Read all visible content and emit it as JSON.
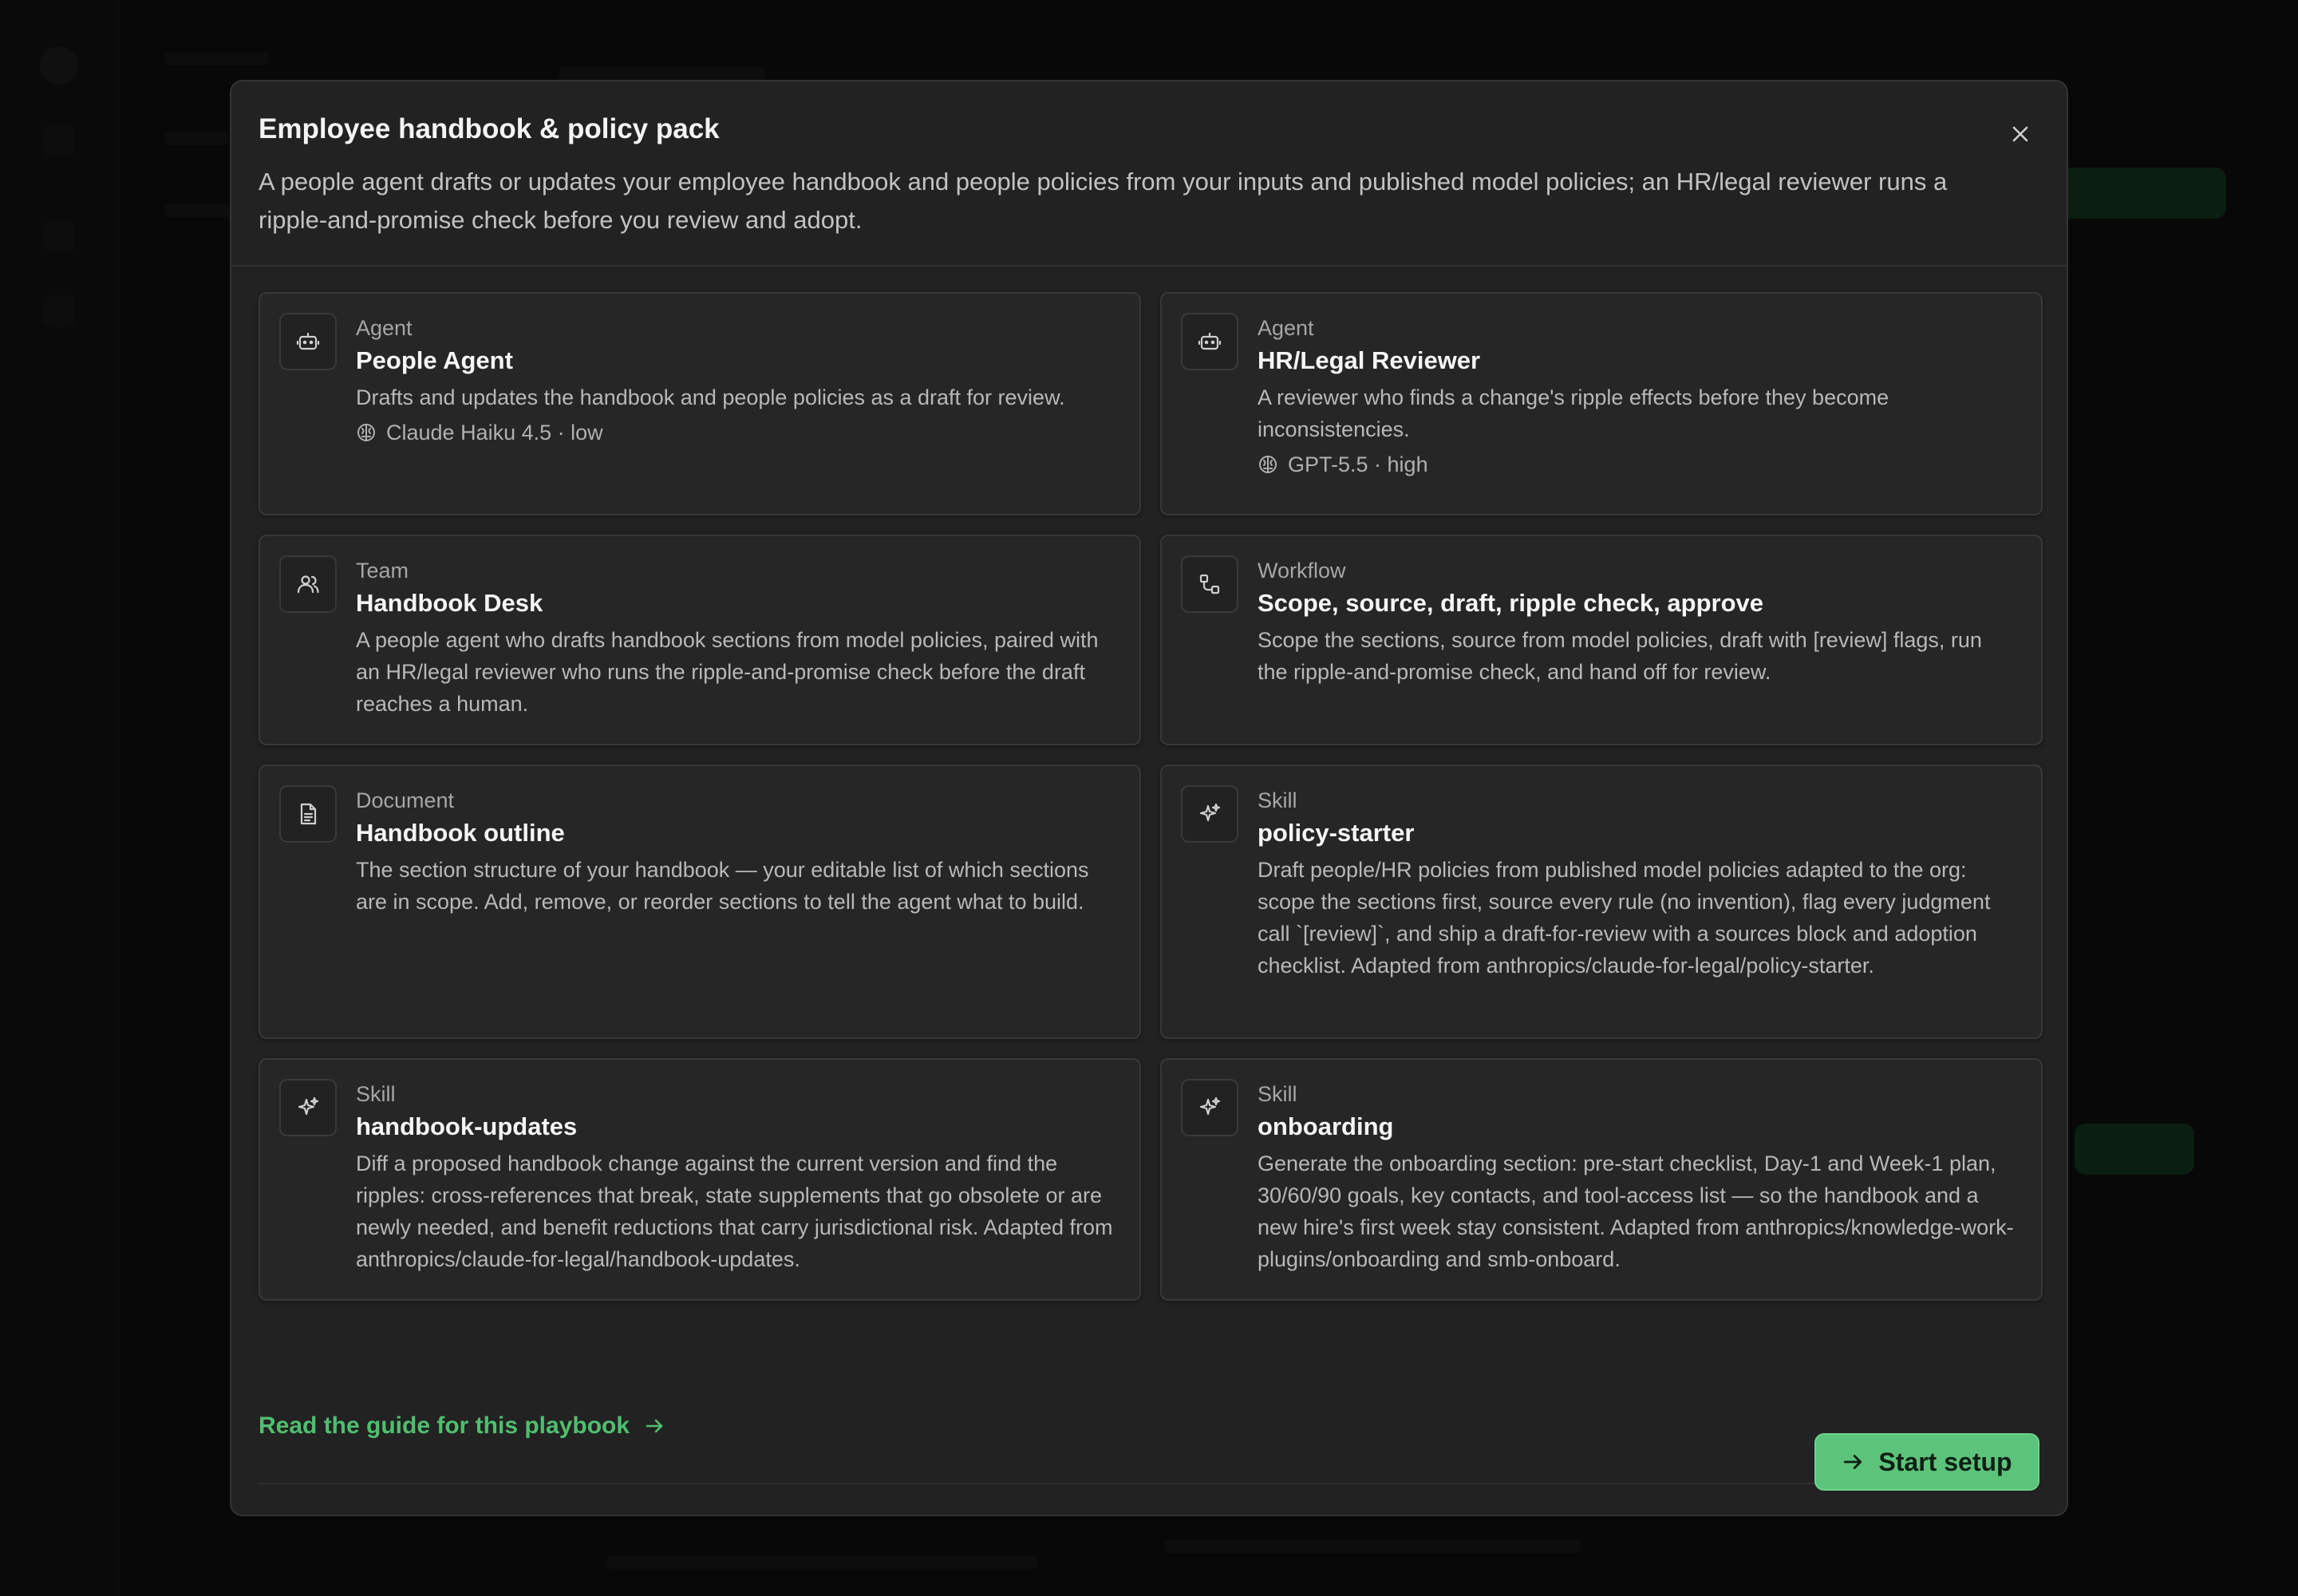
{
  "modal": {
    "title": "Employee handbook & policy pack",
    "description": "A people agent drafts or updates your employee handbook and people policies from your inputs and published model policies; an HR/legal reviewer runs a ripple-and-promise check before you review and adopt."
  },
  "cards": [
    {
      "kind": "Agent",
      "title": "People Agent",
      "description": "Drafts and updates the handbook and people policies as a draft for review.",
      "model": "Claude Haiku 4.5 · low",
      "icon": "robot-icon"
    },
    {
      "kind": "Agent",
      "title": "HR/Legal Reviewer",
      "description": "A reviewer who finds a change's ripple effects before they become inconsistencies.",
      "model": "GPT-5.5 · high",
      "icon": "robot-icon"
    },
    {
      "kind": "Team",
      "title": "Handbook Desk",
      "description": "A people agent who drafts handbook sections from model policies, paired with an HR/legal reviewer who runs the ripple-and-promise check before the draft reaches a human.",
      "icon": "users-icon"
    },
    {
      "kind": "Workflow",
      "title": "Scope, source, draft, ripple check, approve",
      "description": "Scope the sections, source from model policies, draft with [review] flags, run the ripple-and-promise check, and hand off for review.",
      "icon": "workflow-icon"
    },
    {
      "kind": "Document",
      "title": "Handbook outline",
      "description": "The section structure of your handbook — your editable list of which sections are in scope. Add, remove, or reorder sections to tell the agent what to build.",
      "icon": "document-icon"
    },
    {
      "kind": "Skill",
      "title": "policy-starter",
      "description": "Draft people/HR policies from published model policies adapted to the org: scope the sections first, source every rule (no invention), flag every judgment call `[review]`, and ship a draft-for-review with a sources block and adoption checklist. Adapted from anthropics/claude-for-legal/policy-starter.",
      "icon": "sparkle-icon"
    },
    {
      "kind": "Skill",
      "title": "handbook-updates",
      "description": "Diff a proposed handbook change against the current version and find the ripples: cross-references that break, state supplements that go obsolete or are newly needed, and benefit reductions that carry jurisdictional risk. Adapted from anthropics/claude-for-legal/handbook-updates.",
      "icon": "sparkle-icon"
    },
    {
      "kind": "Skill",
      "title": "onboarding",
      "description": "Generate the onboarding section: pre-start checklist, Day-1 and Week-1 plan, 30/60/90 goals, key contacts, and tool-access list — so the handbook and a new hire's first week stay consistent. Adapted from anthropics/knowledge-work-plugins/onboarding and smb-onboard.",
      "icon": "sparkle-icon"
    }
  ],
  "footer": {
    "guide_link": "Read the guide for this playbook",
    "start_button": "Start setup"
  },
  "colors": {
    "accent": "#5cc47a",
    "link": "#4fbf6e",
    "modal_bg": "#222222"
  }
}
